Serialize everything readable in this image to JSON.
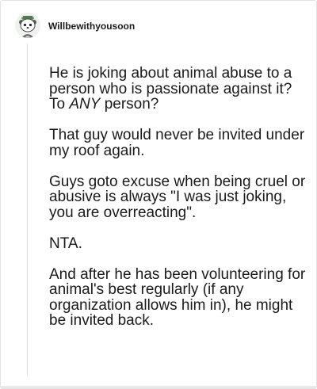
{
  "comment": {
    "username": "Willbewithyousoon",
    "avatar_icon": "snoo-avatar-icon",
    "paragraphs": [
      {
        "before": "He is joking about animal abuse to a person who is passionate against it? To ",
        "emphasis": "ANY",
        "after": " person?"
      },
      {
        "text": "That guy would never be invited under my roof again."
      },
      {
        "text": "Guys goto excuse when being cruel or abusive is always \"I was just joking, you are overreacting\"."
      },
      {
        "text": "NTA."
      },
      {
        "text": "And after he has been volunteering for animal's best regularly (if any organization allows him in), he might be invited back."
      }
    ]
  },
  "colors": {
    "text": "#1a1a1a",
    "thread_line": "#dedede",
    "border": "#e3e3e3"
  }
}
